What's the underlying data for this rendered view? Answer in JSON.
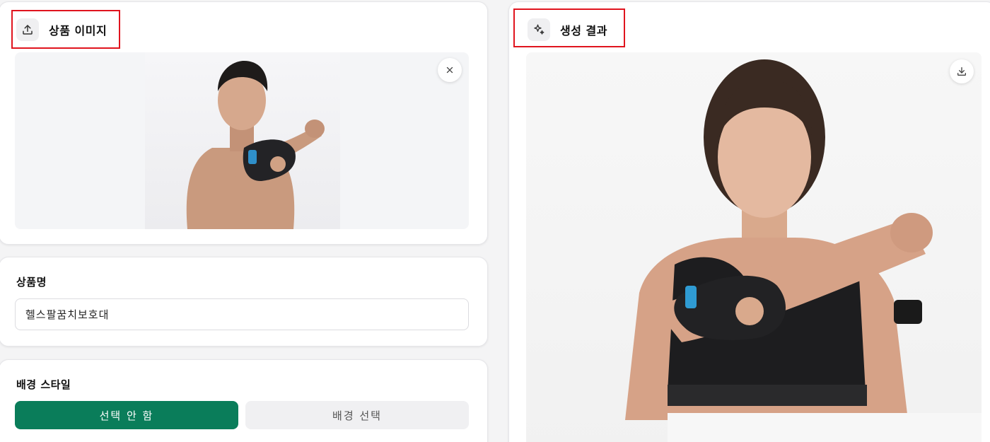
{
  "upload_card": {
    "title": "상품 이미지",
    "header_icon": "upload-icon",
    "remove_icon": "close-icon"
  },
  "name_card": {
    "label": "상품명",
    "value": "헬스팔꿈치보호대"
  },
  "background_card": {
    "label": "배경 스타일",
    "options": [
      "선택 안 함",
      "배경 선택"
    ],
    "selected": "선택 안 함"
  },
  "result_card": {
    "title": "생성 결과",
    "header_icon": "sparkles-icon",
    "download_icon": "download-icon"
  },
  "colors": {
    "accent": "#0a7d5a",
    "highlight_box": "#e0141e"
  }
}
